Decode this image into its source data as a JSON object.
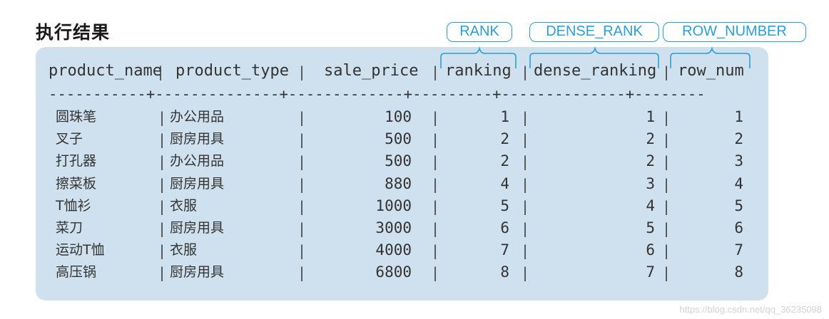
{
  "title": "执行结果",
  "tags": [
    {
      "label": "RANK"
    },
    {
      "label": "DENSE_RANK"
    },
    {
      "label": "ROW_NUMBER"
    }
  ],
  "headers": [
    "product_name",
    "product_type",
    "sale_price",
    "ranking",
    "dense_ranking",
    "row_num"
  ],
  "divider": "-----------+--------------+-------------+---------+--------------+--------",
  "rows": [
    {
      "product_name": "圆珠笔",
      "product_type": "办公用品",
      "sale_price": "100",
      "ranking": "1",
      "dense_ranking": "1",
      "row_num": "1"
    },
    {
      "product_name": "叉子",
      "product_type": "厨房用具",
      "sale_price": "500",
      "ranking": "2",
      "dense_ranking": "2",
      "row_num": "2"
    },
    {
      "product_name": "打孔器",
      "product_type": "办公用品",
      "sale_price": "500",
      "ranking": "2",
      "dense_ranking": "2",
      "row_num": "3"
    },
    {
      "product_name": "擦菜板",
      "product_type": "厨房用具",
      "sale_price": "880",
      "ranking": "4",
      "dense_ranking": "3",
      "row_num": "4"
    },
    {
      "product_name": "T恤衫",
      "product_type": "衣服",
      "sale_price": "1000",
      "ranking": "5",
      "dense_ranking": "4",
      "row_num": "5"
    },
    {
      "product_name": "菜刀",
      "product_type": "厨房用具",
      "sale_price": "3000",
      "ranking": "6",
      "dense_ranking": "5",
      "row_num": "6"
    },
    {
      "product_name": "运动T恤",
      "product_type": "衣服",
      "sale_price": "4000",
      "ranking": "7",
      "dense_ranking": "6",
      "row_num": "7"
    },
    {
      "product_name": "高压锅",
      "product_type": "厨房用具",
      "sale_price": "6800",
      "ranking": "8",
      "dense_ranking": "7",
      "row_num": "8"
    }
  ],
  "watermark": "https://blog.csdn.net/qq_36235098",
  "colors": {
    "accent": "#2a9fd6",
    "panel": "#cfe0ef"
  }
}
